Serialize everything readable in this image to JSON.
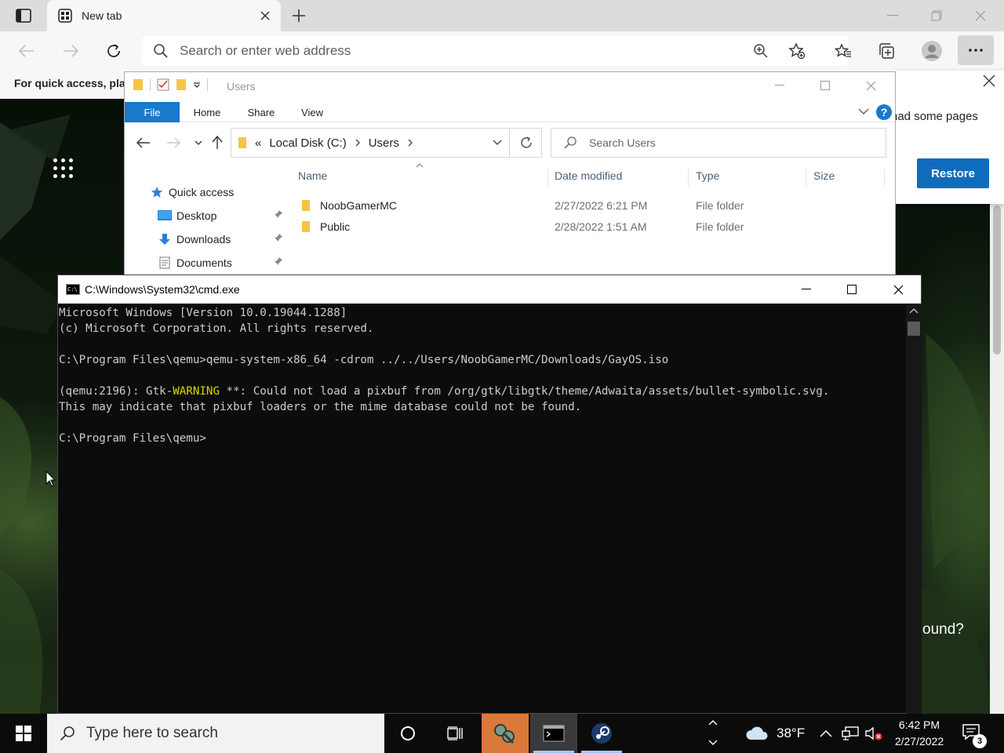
{
  "browser": {
    "tab_title": "New tab",
    "address_placeholder": "Search or enter web address",
    "quick_access_text": "For quick access, plac",
    "restore_message": "had some pages",
    "restore_button": "Restore",
    "found_text": "ound?",
    "accent": "#0f6cbd"
  },
  "explorer": {
    "title": "Users",
    "ribbon_tabs": [
      "File",
      "Home",
      "Share",
      "View"
    ],
    "breadcrumb": {
      "prefix": "«",
      "items": [
        "Local Disk (C:)",
        "Users"
      ]
    },
    "search_placeholder": "Search Users",
    "help": "?",
    "sidebar": [
      {
        "label": "Quick access",
        "icon": "star-icon"
      },
      {
        "label": "Desktop",
        "icon": "desktop-icon"
      },
      {
        "label": "Downloads",
        "icon": "download-icon"
      },
      {
        "label": "Documents",
        "icon": "document-icon"
      }
    ],
    "columns": [
      "Name",
      "Date modified",
      "Type",
      "Size"
    ],
    "rows": [
      {
        "name": "NoobGamerMC",
        "date": "2/27/2022 6:21 PM",
        "type": "File folder"
      },
      {
        "name": "Public",
        "date": "2/28/2022 1:51 AM",
        "type": "File folder"
      }
    ]
  },
  "cmd": {
    "title": "C:\\Windows\\System32\\cmd.exe",
    "icon_text": "C:\\",
    "lines": [
      "Microsoft Windows [Version 10.0.19044.1288]",
      "(c) Microsoft Corporation. All rights reserved.",
      "",
      "C:\\Program Files\\qemu>qemu-system-x86_64 -cdrom ../../Users/NoobGamerMC/Downloads/GayOS.iso",
      "",
      "",
      "This may indicate that pixbuf loaders or the mime database could not be found.",
      "",
      "C:\\Program Files\\qemu>"
    ],
    "warning_line": {
      "prefix": "(qemu:2196): Gtk-",
      "keyword": "WARNING",
      "suffix": " **: Could not load a pixbuf from /org/gtk/libgtk/theme/Adwaita/assets/bullet-symbolic.svg."
    }
  },
  "taskbar": {
    "search_placeholder": "Type here to search",
    "weather": "38°F",
    "time": "6:42 PM",
    "date": "2/27/2022",
    "notification_count": "3"
  }
}
